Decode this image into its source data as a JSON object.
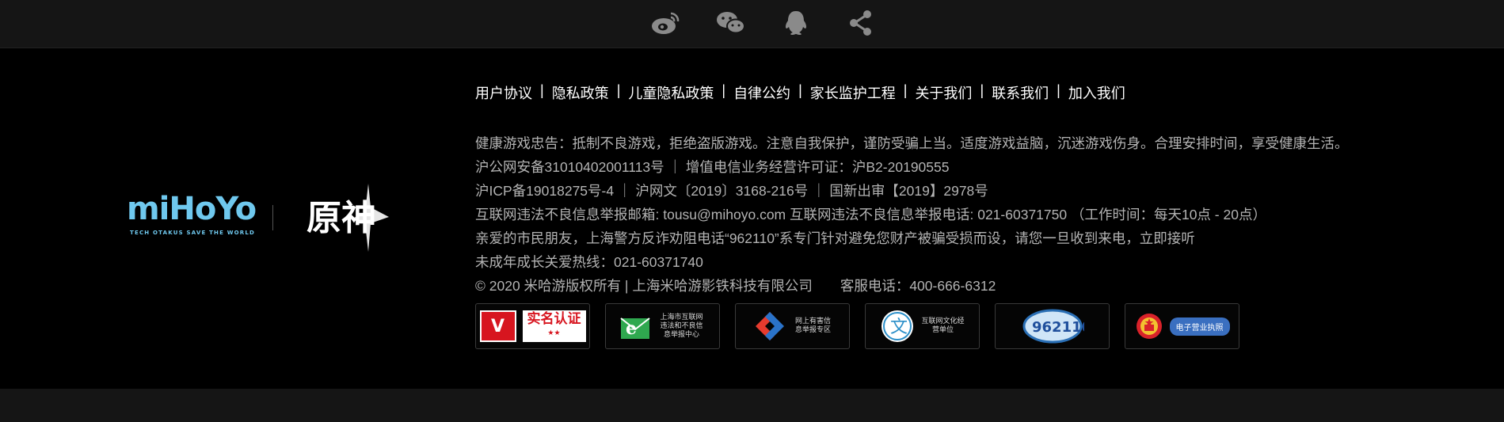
{
  "social": {
    "icons": [
      "weibo-icon",
      "wechat-icon",
      "qq-icon",
      "share-icon"
    ],
    "icon_color": "#8a8a8a"
  },
  "brand": {
    "mihoyo_word": "miHoYo",
    "mihoyo_tagline": "TECH OTAKUS SAVE THE WORLD",
    "genshin_logo": "原神",
    "accent": "#6fc8ee"
  },
  "links": [
    "用户协议",
    "隐私政策",
    "儿童隐私政策",
    "自律公约",
    "家长监护工程",
    "关于我们",
    "联系我们",
    "加入我们"
  ],
  "link_separator": "|",
  "info": {
    "line1": "健康游戏忠告：抵制不良游戏，拒绝盗版游戏。注意自我保护，谨防受骗上当。适度游戏益脑，沉迷游戏伤身。合理安排时间，享受健康生活。",
    "line2": "沪公网安备31010402001113号 ｜ 增值电信业务经营许可证：沪B2-20190555",
    "line3": "沪ICP备19018275号-4 ｜ 沪网文〔2019〕3168-216号 ｜ 国新出审【2019】2978号",
    "line4": "互联网违法不良信息举报邮箱: tousu@mihoyo.com 互联网违法不良信息举报电话: 021-60371750 （工作时间：每天10点 - 20点）",
    "line5": "亲爱的市民朋友，上海警方反诈劝阻电话“962110”系专门针对避免您财产被骗受损而设，请您一旦收到来电，立即接听",
    "line6": "未成年成长关爱热线：021-60371740",
    "line7": "© 2020 米哈游版权所有 | 上海米哈游影铁科技有限公司　　客服电话：400-666-6312"
  },
  "badges": {
    "b1_mark": "V",
    "b1_label": "实名认证",
    "b1_stars": "★★",
    "b2_label": "上海市互联网违法和不良信息举报中心",
    "b3_label": "网上有害信息举报专区",
    "b4_label": "互联网文化经营单位",
    "b5_label": "962110",
    "b6_label": "电子营业执照"
  }
}
